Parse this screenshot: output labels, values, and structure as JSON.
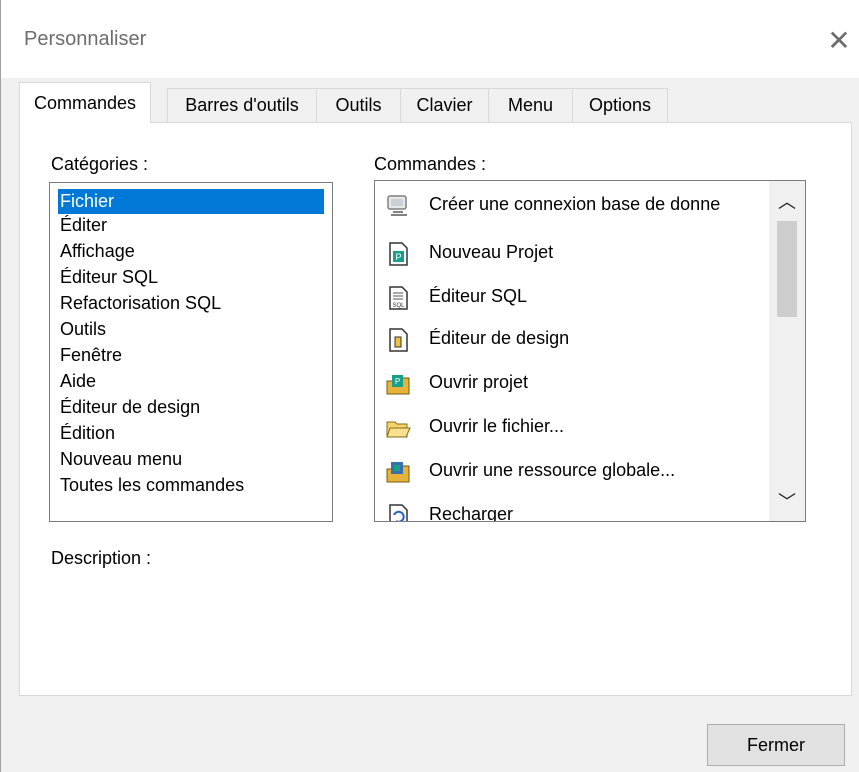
{
  "window": {
    "title": "Personnaliser",
    "close_glyph": "✕"
  },
  "tabs": [
    {
      "label": "Commandes",
      "active": true
    },
    {
      "label": "Barres d'outils"
    },
    {
      "label": "Outils"
    },
    {
      "label": "Clavier"
    },
    {
      "label": "Menu"
    },
    {
      "label": "Options"
    }
  ],
  "categories": {
    "label": "Catégories :",
    "items": [
      "Fichier",
      "Éditer",
      "Affichage",
      "Éditeur SQL",
      "Refactorisation SQL",
      "Outils",
      "Fenêtre",
      "Aide",
      "Éditeur de design",
      "Édition",
      "Nouveau menu",
      "Toutes les commandes"
    ],
    "selected": "Fichier"
  },
  "commands": {
    "label": "Commandes :",
    "items": [
      {
        "label": "Créer une connexion base de donne",
        "icon": "database-connection-icon"
      },
      {
        "label": "Nouveau Projet",
        "icon": "new-project-icon"
      },
      {
        "label": "Éditeur SQL",
        "icon": "sql-editor-icon"
      },
      {
        "label": "Éditeur de design",
        "icon": "design-editor-icon"
      },
      {
        "label": "Ouvrir projet",
        "icon": "open-project-icon"
      },
      {
        "label": "Ouvrir le fichier...",
        "icon": "open-folder-icon"
      },
      {
        "label": "Ouvrir une ressource globale...",
        "icon": "global-resource-icon"
      },
      {
        "label": "Recharger",
        "icon": "reload-icon"
      }
    ]
  },
  "description": {
    "label": "Description :"
  },
  "footer": {
    "close_button": "Fermer"
  },
  "colors": {
    "selection": "#0078d7",
    "panel": "#ffffff",
    "chrome": "#f0f0f0"
  }
}
